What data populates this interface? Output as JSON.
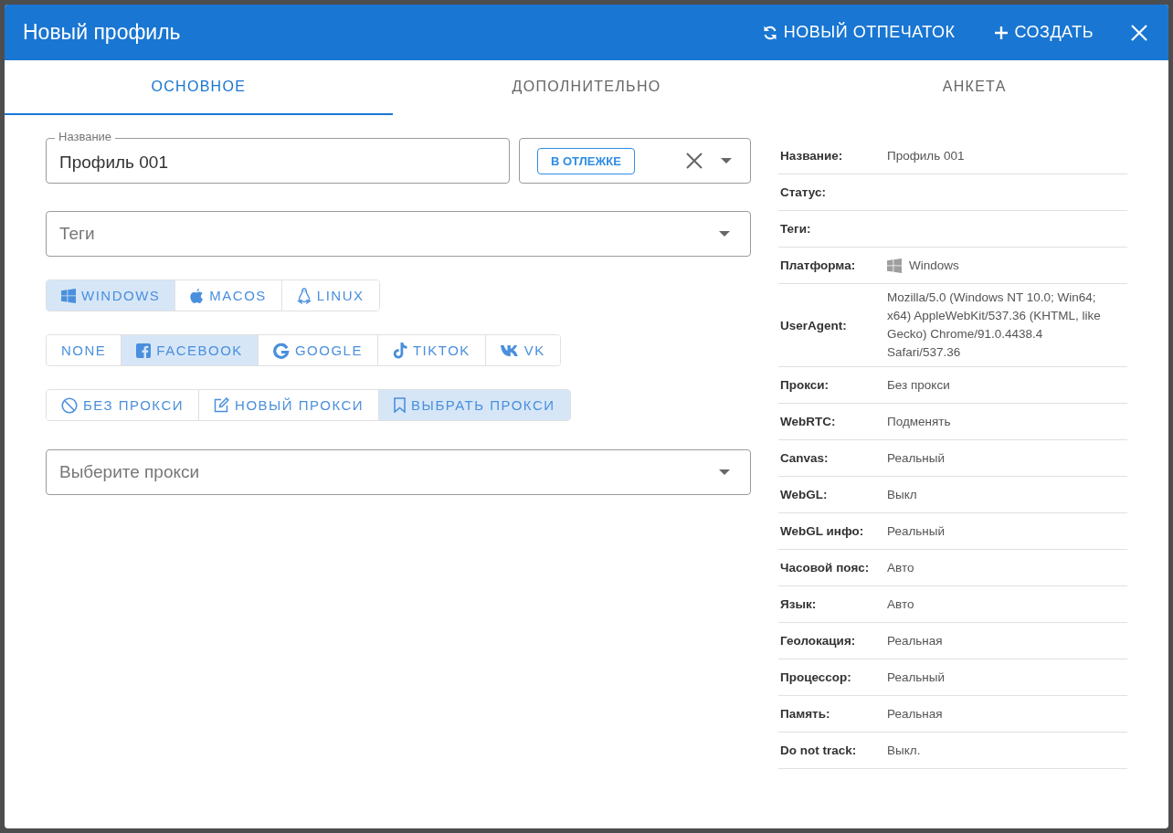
{
  "window": {
    "title": "Новый профиль"
  },
  "header_actions": [
    {
      "kind": "refresh",
      "label": "НОВЫЙ ОТПЕЧАТОК"
    },
    {
      "kind": "plus",
      "label": "СОЗДАТЬ"
    }
  ],
  "tabs": [
    {
      "label": "ОСНОВНОЕ",
      "selected": true
    },
    {
      "label": "ДОПОЛНИТЕЛЬНО",
      "selected": false
    },
    {
      "label": "АНКЕТА",
      "selected": false
    }
  ],
  "name_field": {
    "label": "Название",
    "value": "Профиль 001"
  },
  "status_select": {
    "chip": "В ОТЛЕЖКЕ"
  },
  "tags_field": {
    "placeholder": "Теги"
  },
  "button_groups": [
    [
      {
        "kind": "windows",
        "label": "WINDOWS",
        "selected": true
      },
      {
        "kind": "apple",
        "label": "MACOS",
        "selected": false
      },
      {
        "kind": "linux",
        "label": "LINUX",
        "selected": false
      }
    ],
    [
      {
        "kind": "text",
        "label": "NONE",
        "selected": false
      },
      {
        "kind": "facebook",
        "label": "FACEBOOK",
        "selected": true
      },
      {
        "kind": "google",
        "label": "GOOGLE",
        "selected": false
      },
      {
        "kind": "tiktok",
        "label": "TIKTOK",
        "selected": false
      },
      {
        "kind": "vk",
        "label": "VK",
        "selected": false
      }
    ],
    [
      {
        "kind": "ban",
        "label": "БЕЗ ПРОКСИ",
        "selected": false
      },
      {
        "kind": "edit",
        "label": "НОВЫЙ ПРОКСИ",
        "selected": false
      },
      {
        "kind": "bookmark",
        "label": "ВЫБРАТЬ ПРОКСИ",
        "selected": true
      }
    ]
  ],
  "proxy_select": {
    "placeholder": "Выберите прокси"
  },
  "summary": [
    {
      "label": "Название:",
      "value": "Профиль 001"
    },
    {
      "label": "Статус:"
    },
    {
      "label": "Теги:"
    },
    {
      "label": "Платформа:",
      "value": "Windows",
      "kind": "windows"
    },
    {
      "label": "UserAgent:",
      "value": "Mozilla/5.0 (Windows NT 10.0; Win64; x64) AppleWebKit/537.36 (KHTML, like Gecko) Chrome/91.0.4438.4 Safari/537.36"
    },
    {
      "label": "Прокси:",
      "value": "Без прокси"
    },
    {
      "label": "WebRTC:",
      "value": "Подменять"
    },
    {
      "label": "Canvas:",
      "value": "Реальный"
    },
    {
      "label": "WebGL:",
      "value": "Выкл"
    },
    {
      "label": "WebGL инфо:",
      "value": "Реальный"
    },
    {
      "label": "Часовой пояс:",
      "value": "Авто"
    },
    {
      "label": "Язык:",
      "value": "Авто"
    },
    {
      "label": "Геолокация:",
      "value": "Реальная"
    },
    {
      "label": "Процессор:",
      "value": "Реальный"
    },
    {
      "label": "Память:",
      "value": "Реальная"
    },
    {
      "label": "Do not track:",
      "value": "Выкл."
    }
  ]
}
